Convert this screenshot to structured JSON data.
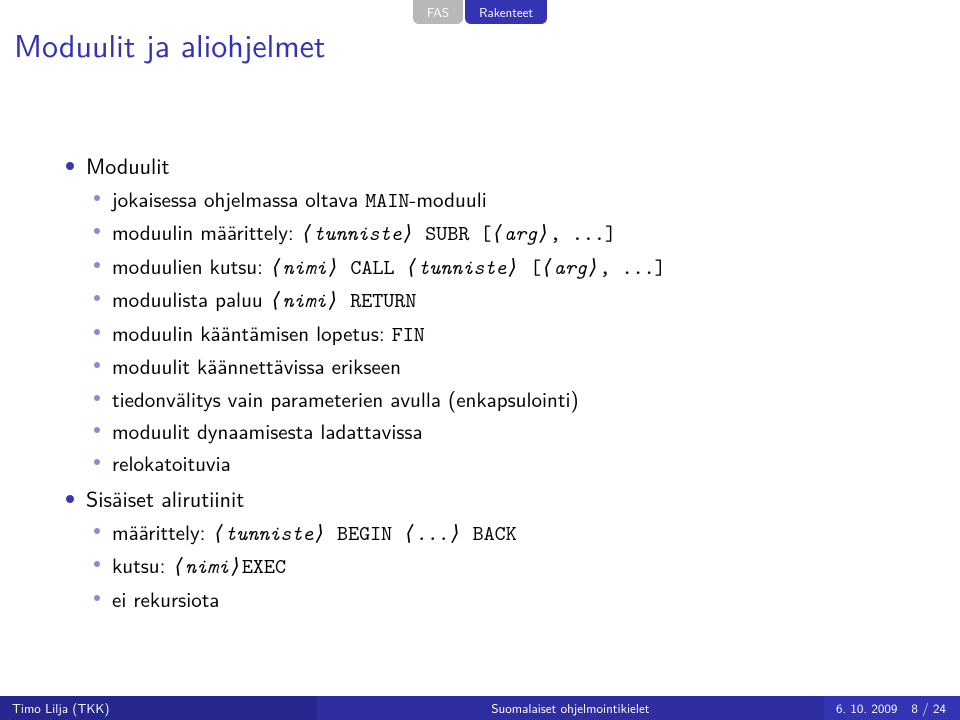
{
  "tabs": {
    "left": "FAS",
    "right": "Rakenteet"
  },
  "title": "Moduulit ja aliohjelmet",
  "items": [
    {
      "label": "Moduulit",
      "sub": [
        {
          "pre": "jokaisessa ohjelmassa oltava ",
          "code1": "MAIN",
          "post": "-moduuli"
        },
        {
          "pre": "moduulin määrittely: ",
          "ang1": "tunniste",
          "code1": " SUBR [",
          "ang2": "arg",
          "code2": ", ...",
          "ang3": "",
          "code3": "]"
        },
        {
          "pre": "moduulien kutsu: ",
          "ang1": "nimi",
          "code1": " CALL ",
          "ang2": "tunniste",
          "code2": " [",
          "ang3": "arg",
          "code3": ", ...",
          "ang4": "",
          "code4": "]"
        },
        {
          "pre": "moduulista paluu ",
          "ang1": "nimi",
          "code1": " RETURN"
        },
        {
          "pre": "moduulin kääntämisen lopetus: ",
          "code1": "FIN"
        },
        {
          "pre": "moduulit käännettävissa erikseen"
        },
        {
          "pre": "tiedonvälitys vain parameterien avulla (enkapsulointi)"
        },
        {
          "pre": "moduulit dynaamisesta ladattavissa"
        },
        {
          "pre": "relokatoituvia"
        }
      ]
    },
    {
      "label": "Sisäiset alirutiinit",
      "sub": [
        {
          "pre": "määrittely: ",
          "ang1": "tunniste",
          "code1": " BEGIN ",
          "ang2": "...",
          "code2": " BACK"
        },
        {
          "pre": "kutsu: ",
          "code1": "EXEC ",
          "ang1": "nimi"
        },
        {
          "pre": "ei rekursiota"
        }
      ]
    }
  ],
  "footer": {
    "author": "Timo Lilja (TKK)",
    "talk": "Suomalaiset ohjelmointikielet",
    "date": "6. 10. 2009",
    "page": "8 / 24"
  }
}
